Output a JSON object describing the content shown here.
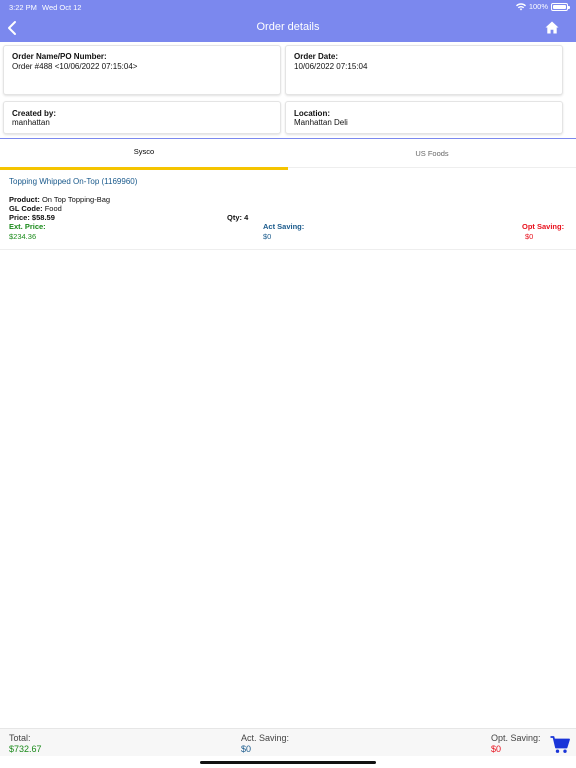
{
  "status_bar": {
    "time": "3:22 PM",
    "date": "Wed Oct 12",
    "battery": "100%"
  },
  "header": {
    "title": "Order details"
  },
  "cards": {
    "order_name": {
      "label": "Order Name/PO Number:",
      "value": "Order #488 <10/06/2022 07:15:04>"
    },
    "order_date": {
      "label": "Order Date:",
      "value": "10/06/2022 07:15:04"
    },
    "created_by": {
      "label": "Created by:",
      "value": "manhattan"
    },
    "location": {
      "label": "Location:",
      "value": "Manhattan Deli"
    }
  },
  "tabs": [
    {
      "label": "Sysco",
      "active": true
    },
    {
      "label": "US Foods",
      "active": false
    }
  ],
  "items": [
    {
      "title": "Topping Whipped On-Top (1169960)",
      "product_label": "Product:",
      "product_value": "On Top Topping-Bag",
      "gl_code_label": "GL Code:",
      "gl_code_value": "Food",
      "price": "Price: $58.59",
      "qty": "Qty: 4",
      "ext_price_label": "Ext. Price:",
      "ext_price_value": "$234.36",
      "act_saving_label": "Act Saving:",
      "act_saving_value": "$0",
      "opt_saving_label": "Opt Saving:",
      "opt_saving_value": "$0"
    }
  ],
  "footer": {
    "total_label": "Total:",
    "total_value": "$732.67",
    "act_saving_label": "Act. Saving:",
    "act_saving_value": "$0",
    "opt_saving_label": "Opt. Saving:",
    "opt_saving_value": "$0"
  },
  "colors": {
    "header_bg": "#7b88ee",
    "tab_indicator": "#f5c400",
    "green": "#1a8a1a",
    "blue": "#1a5a8c",
    "red": "#e8111d",
    "cart": "#1a35d8"
  },
  "icons": [
    "back-chevron-icon",
    "home-icon",
    "wifi-icon",
    "battery-icon",
    "cart-icon"
  ]
}
